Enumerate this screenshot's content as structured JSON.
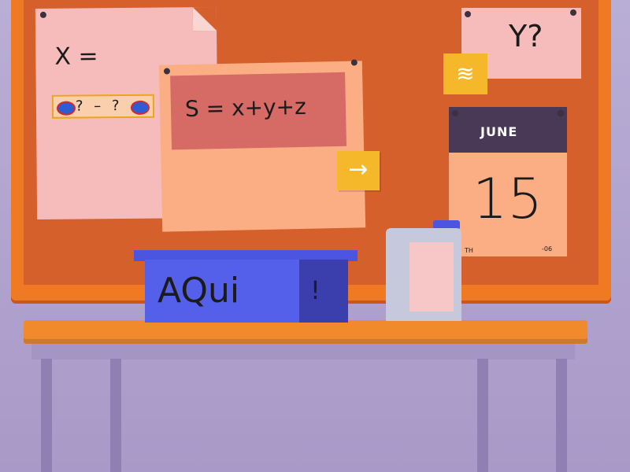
{
  "board": {
    "paper_x": {
      "label": "X =",
      "slot_text": "?  –  ?"
    },
    "paper_sum": {
      "formula": "S = x+y+z"
    },
    "arrow_button": {
      "icon": "→"
    },
    "paper_y": {
      "label": "Y?"
    },
    "sticky_note": {
      "icon": "≋"
    },
    "calendar": {
      "month": "JUNE",
      "day": "15",
      "day_suffix": "TH",
      "year": "-06"
    }
  },
  "desk": {
    "box_label": "AQui",
    "box_mark": "!"
  },
  "colors": {
    "board": "#d6602c",
    "frame": "#f07a24",
    "sticky": "#f5b82a",
    "box": "#5560ea",
    "calendar_header": "#4a3857"
  }
}
